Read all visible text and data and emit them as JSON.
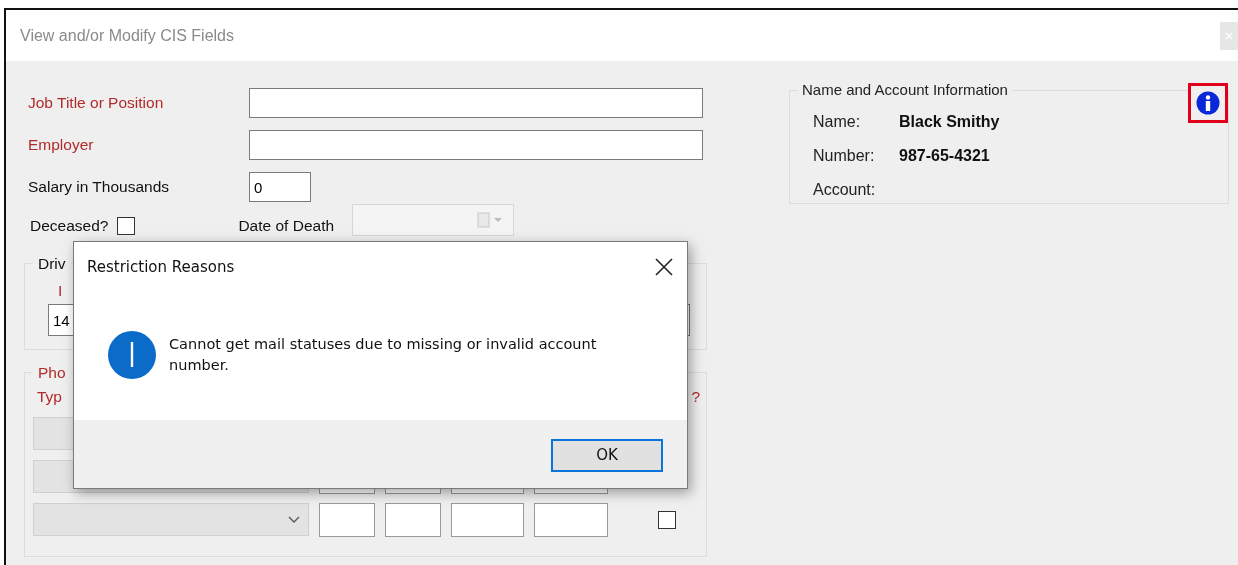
{
  "window": {
    "title": "View and/or Modify CIS Fields"
  },
  "form": {
    "fields": [
      {
        "label": "Job Title or Position",
        "required": true,
        "kind": "wide"
      },
      {
        "label": "Employer",
        "required": true,
        "kind": "wide"
      },
      {
        "label": "Salary in Thousands",
        "required": false,
        "value": "0",
        "kind": "short"
      }
    ],
    "deceased": {
      "label": "Deceased?",
      "checked": false
    },
    "date_of_death": {
      "label": "Date of Death"
    },
    "driver_group": {
      "legend": "Driv",
      "id_label": "I",
      "id_value": "14"
    },
    "phone_group": {
      "legend": "Pho",
      "type_label": "Typ",
      "flag_label": "?",
      "rows": [
        {
          "checked": false
        }
      ]
    }
  },
  "name_panel": {
    "legend": "Name and Account Information",
    "rows": [
      {
        "label": "Name:",
        "value": "Black Smithy"
      },
      {
        "label": "Number:",
        "value": "987-65-4321"
      },
      {
        "label": "Account:"
      }
    ]
  },
  "dialog": {
    "title": "Restriction Reasons",
    "message": "Cannot get mail statuses due to missing or invalid account number.",
    "button": "OK"
  }
}
